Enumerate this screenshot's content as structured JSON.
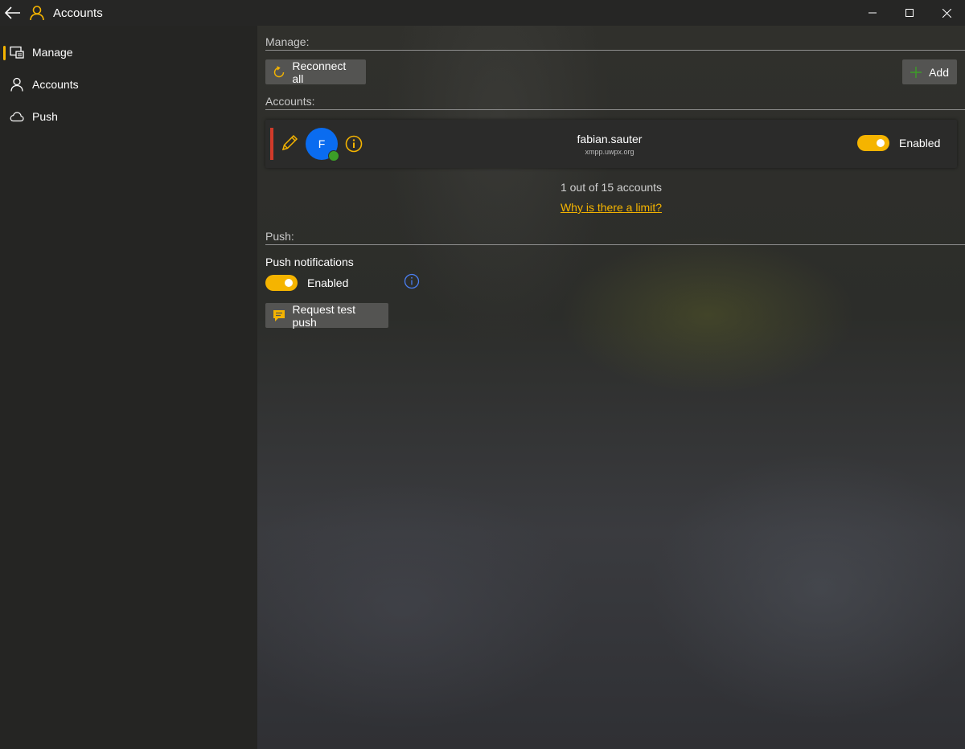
{
  "window": {
    "title": "Accounts",
    "accent": "#f5b400"
  },
  "sidebar": {
    "items": [
      {
        "label": "Manage",
        "icon": "manage-icon",
        "selected": true
      },
      {
        "label": "Accounts",
        "icon": "person-icon",
        "selected": false
      },
      {
        "label": "Push",
        "icon": "cloud-icon",
        "selected": false
      }
    ]
  },
  "manage": {
    "header": "Manage:",
    "reconnect_label": "Reconnect all",
    "add_label": "Add"
  },
  "accounts": {
    "header": "Accounts:",
    "list": [
      {
        "avatar_letter": "F",
        "name": "fabian.sauter",
        "domain": "xmpp.uwpx.org",
        "enabled_label": "Enabled",
        "enabled": true,
        "status_color": "#d13a2a",
        "presence_color": "#3c9d27"
      }
    ],
    "count_text": "1 out of 15 accounts",
    "limit_link": "Why is there a limit?"
  },
  "push": {
    "header": "Push:",
    "title": "Push notifications",
    "enabled_label": "Enabled",
    "enabled": true,
    "test_label": "Request test push"
  }
}
